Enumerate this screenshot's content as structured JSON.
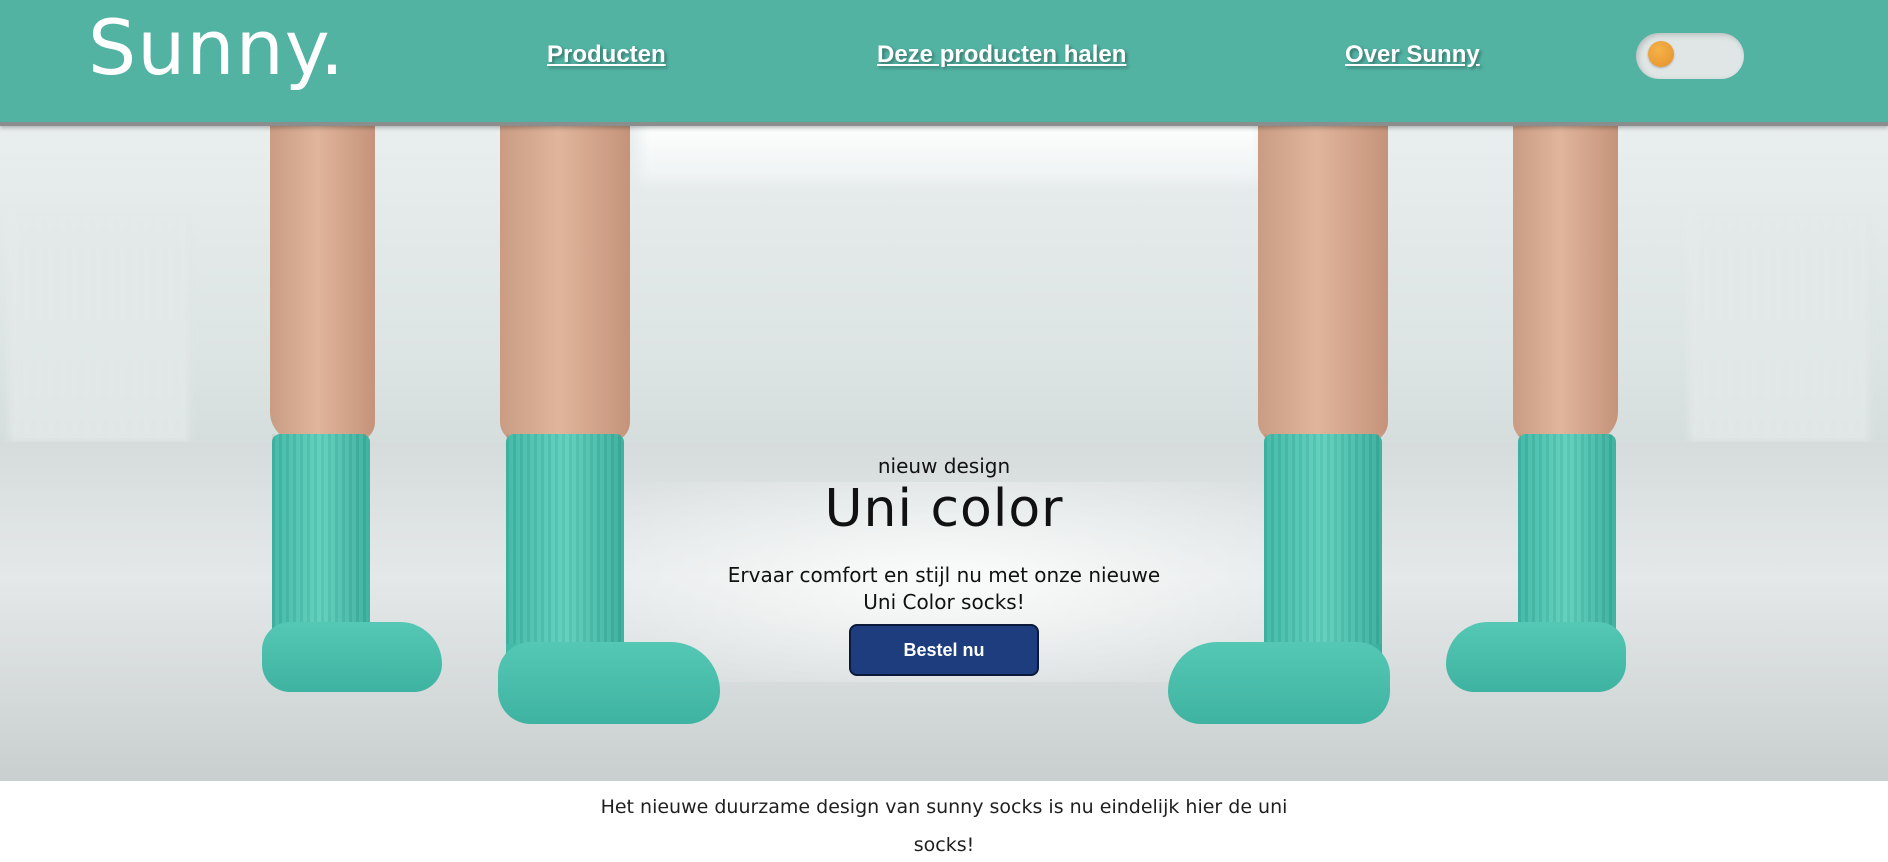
{
  "header": {
    "logo": "Sunny.",
    "nav": [
      {
        "label": "Producten"
      },
      {
        "label": "Deze producten halen"
      },
      {
        "label": "Over Sunny"
      }
    ],
    "theme_toggle": {
      "state": "off",
      "knob_color": "#e99a2f"
    }
  },
  "hero": {
    "eyebrow": "nieuw design",
    "title": "Uni color",
    "description": "Ervaar comfort en stijl nu met onze nieuwe Uni Color socks!",
    "cta_label": "Bestel nu",
    "background": "photo-legs-teal-socks"
  },
  "intro": {
    "text": "Het nieuwe duurzame design van sunny socks is nu eindelijk hier de uni socks!"
  },
  "colors": {
    "header_bg": "#52b3a3",
    "cta_bg": "#1d3d7e",
    "sock": "#4cc3b0"
  }
}
